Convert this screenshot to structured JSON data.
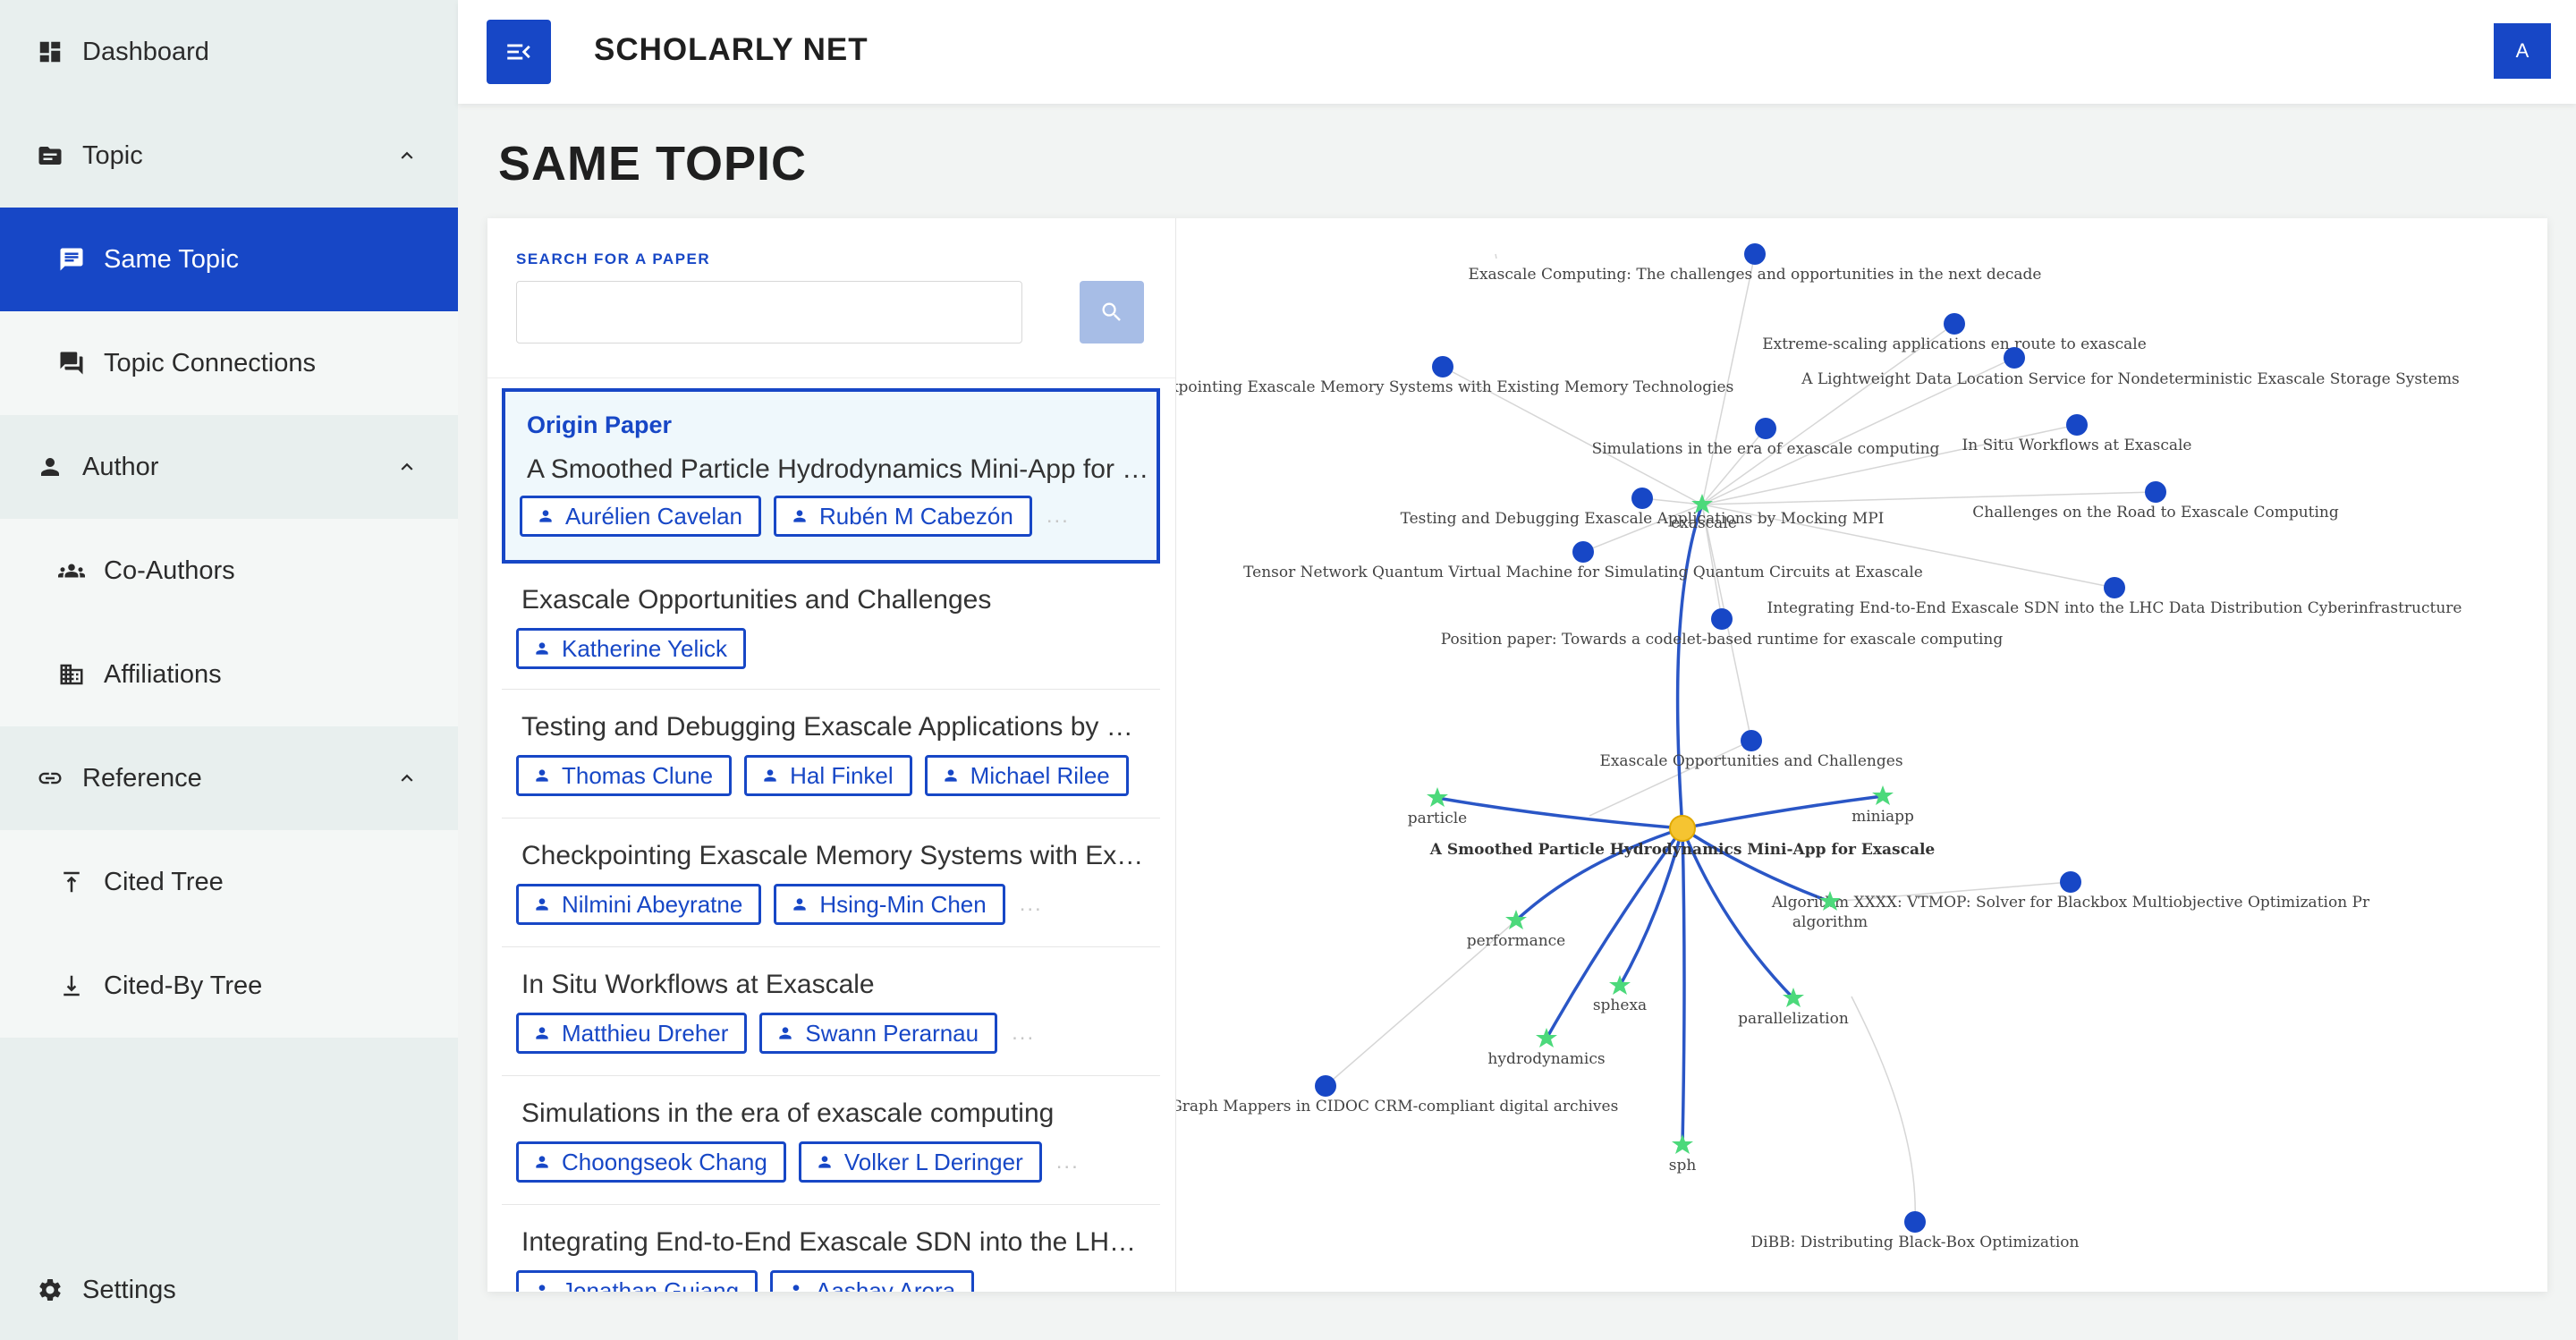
{
  "sidebar": {
    "dashboard": "Dashboard",
    "topic": "Topic",
    "same_topic": "Same Topic",
    "topic_connections": "Topic Connections",
    "author": "Author",
    "co_authors": "Co-Authors",
    "affiliations": "Affiliations",
    "reference": "Reference",
    "cited_tree": "Cited Tree",
    "cited_by_tree": "Cited-By Tree",
    "settings": "Settings"
  },
  "topbar": {
    "title": "SCHOLARLY NET",
    "avatar_letter": "A",
    "menu_icon": "menu-collapse-icon"
  },
  "page": {
    "title": "SAME TOPIC"
  },
  "search": {
    "label": "SEARCH FOR A PAPER",
    "value": "",
    "placeholder": ""
  },
  "origin": {
    "label": "Origin Paper",
    "title": "A Smoothed Particle Hydrodynamics Mini-App for Exascale",
    "authors": [
      "Aurélien Cavelan",
      "Rubén M Cabezón"
    ],
    "more": "..."
  },
  "papers": [
    {
      "title": "Exascale Opportunities and Challenges",
      "authors": [
        "Katherine Yelick"
      ],
      "more": ""
    },
    {
      "title": "Testing and Debugging Exascale Applications by Mocking MPI",
      "authors": [
        "Thomas Clune",
        "Hal Finkel",
        "Michael Rilee"
      ],
      "more": ""
    },
    {
      "title": "Checkpointing Exascale Memory Systems with Existing Memory Technologies",
      "authors": [
        "Nilmini Abeyratne",
        "Hsing-Min Chen"
      ],
      "more": "..."
    },
    {
      "title": "In Situ Workflows at Exascale",
      "authors": [
        "Matthieu Dreher",
        "Swann Perarnau"
      ],
      "more": "..."
    },
    {
      "title": "Simulations in the era of exascale computing",
      "authors": [
        "Choongseok Chang",
        "Volker L Deringer"
      ],
      "more": "..."
    },
    {
      "title": "Integrating End-to-End Exascale SDN into the LHC Data Distribution Cyberinfrastructure",
      "authors": [
        "Jonathan Guiang",
        "Aashay Arora"
      ],
      "more": "..."
    }
  ],
  "graph": {
    "colors": {
      "paper_node": "#1747c6",
      "topic_node": "#4cd97b",
      "origin_node": "#f5c431",
      "strong_edge": "#2a56c6",
      "weak_edge": "#d6d6d6"
    },
    "center_label": "A Smoothed Particle Hydrodynamics Mini-App for Exascale",
    "topics": {
      "exascale": "exascale",
      "particle": "particle",
      "miniapp": "miniapp",
      "performance": "performance",
      "algorithm": "algorithm",
      "sphexa": "sphexa",
      "parallelization": "parallelization",
      "hydrodynamics": "hydrodynamics",
      "sph": "sph"
    },
    "papers": {
      "p1": "Exascale Computing: The challenges and opportunities in the next decade",
      "p2": "Extreme-scaling applications en route to exascale",
      "p3": "eckpointing Exascale Memory Systems with Existing Memory Technologies",
      "p4": "A Lightweight Data Location Service for Nondeterministic Exascale Storage Systems",
      "p5": "Simulations in the era of exascale computing",
      "p6": "In Situ Workflows at Exascale",
      "p7": "Testing and Debugging Exascale Applications by Mocking MPI",
      "p8": "Challenges on the Road to Exascale Computing",
      "p9": "Tensor Network Quantum Virtual Machine for Simulating Quantum Circuits at Exascale",
      "p10": "Integrating End-to-End Exascale SDN into the LHC Data Distribution Cyberinfrastructure",
      "p11": "Position paper: Towards a codelet-based runtime for exascale computing",
      "p12": "Exascale Opportunities and Challenges",
      "p13": "Algorithm XXXX: VTMOP: Solver for Blackbox Multiobjective Optimization Pr",
      "p14": "bases and Object-Graph Mappers in CIDOC CRM-compliant digital archives",
      "p15": "DiBB: Distributing Black-Box Optimization"
    }
  }
}
